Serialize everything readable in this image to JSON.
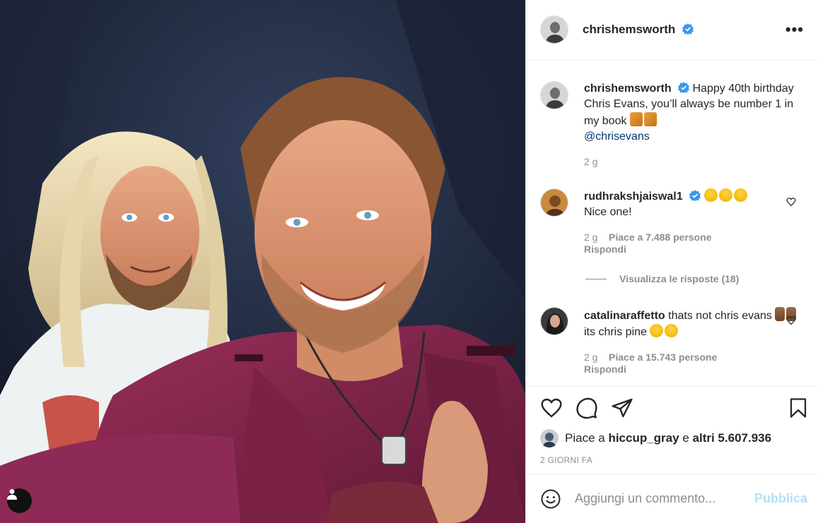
{
  "post": {
    "author": "chrishemsworth",
    "menu_icon": "more-horizontal-icon"
  },
  "caption": {
    "author": "chrishemsworth",
    "text": "Happy 40th birthday Chris Evans, you’ll always be number 1 in my book",
    "mention": "@chrisevans",
    "time": "2 g"
  },
  "comments": [
    {
      "author": "rudhrakshjaiswal1",
      "text": "Nice one!",
      "time": "2 g",
      "likes": "Piace a 7.488 persone",
      "reply": "Rispondi",
      "view_replies": "Visualizza le risposte (18)"
    },
    {
      "author": "catalinaraffetto",
      "text": "thats not chris evans",
      "text2": "its chris pine",
      "time": "2 g",
      "likes": "Piace a 15.743 persone",
      "reply": "Rispondi"
    }
  ],
  "likes": {
    "prefix": "Piace a",
    "user": "hiccup_gray",
    "conj": "e",
    "others": "altri 5.607.936"
  },
  "timestamp": "2 GIORNI FA",
  "add_comment": {
    "placeholder": "Aggiungi un commento...",
    "publish": "Pubblica"
  },
  "colors": {
    "verified": "#3897f0",
    "link": "#00376b",
    "publish_disabled": "#b2dffc",
    "secondary_text": "#8e8e8e"
  }
}
